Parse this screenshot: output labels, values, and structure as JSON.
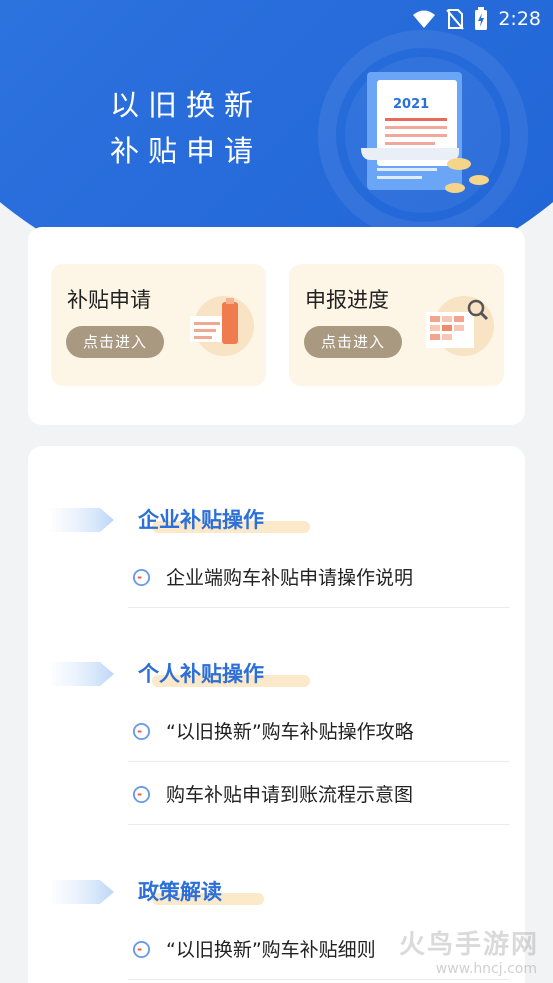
{
  "status_bar": {
    "time": "2:28",
    "icons": [
      "wifi-icon",
      "no-sim-icon",
      "battery-charging-icon"
    ]
  },
  "hero": {
    "title_line1": "以旧换新",
    "title_line2": "补贴申请",
    "illustration_year": "2021"
  },
  "quick_actions": [
    {
      "title": "补贴申请",
      "button": "点击进入",
      "icon": "subsidy-form-illustration"
    },
    {
      "title": "申报进度",
      "button": "点击进入",
      "icon": "progress-chart-illustration"
    }
  ],
  "sections": [
    {
      "title": "企业补贴操作",
      "items": [
        "企业端购车补贴申请操作说明"
      ]
    },
    {
      "title": "个人补贴操作",
      "items": [
        "“以旧换新”购车补贴操作攻略",
        "购车补贴申请到账流程示意图"
      ]
    },
    {
      "title": "政策解读",
      "items": [
        "“以旧换新”购车补贴细则"
      ]
    }
  ],
  "watermark": {
    "text": "火鸟手游网",
    "url": "www.hncj.com"
  },
  "colors": {
    "primary": "#2a6fdc",
    "section_title": "#2c6fd8",
    "tile_bg": "#fdf5e6",
    "tile_button": "#a89980"
  }
}
